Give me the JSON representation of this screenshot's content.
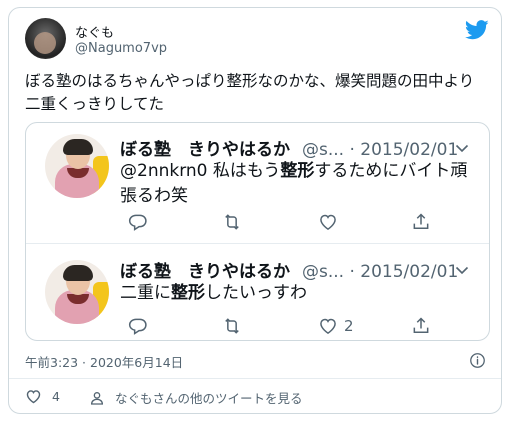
{
  "tweet": {
    "author_name": "なぐも",
    "author_handle": "@Nagumo7vp",
    "text": "ぼる塾のはるちゃんやっぱり整形なのかな、爆笑問題の田中より二重くっきりしてた",
    "timestamp": "午前3:23 · 2020年6月14日",
    "like_count": "4",
    "more_label": "なぐもさんの他のツイートを見る"
  },
  "quotes": [
    {
      "name": "ぼる塾　きりやはるか",
      "handle": "@s...",
      "separator": "·",
      "date": "2015/02/01",
      "text_before": "@2nnkrn0 私はもう",
      "text_bold": "整形",
      "text_after": "するためにバイト頑張るわ笑",
      "like_count": ""
    },
    {
      "name": "ぼる塾　きりやはるか",
      "handle": "@s...",
      "separator": "·",
      "date": "2015/02/01",
      "text_before": "二重に",
      "text_bold": "整形",
      "text_after": "したいっすわ",
      "like_count": "2"
    }
  ],
  "colors": {
    "twitter_blue": "#1d9bf0",
    "muted": "#536471",
    "border": "#cfd9de"
  },
  "icons": [
    "twitter-logo-icon",
    "chevron-down-icon",
    "reply-icon",
    "retweet-icon",
    "like-icon",
    "share-icon",
    "info-icon",
    "person-icon"
  ]
}
